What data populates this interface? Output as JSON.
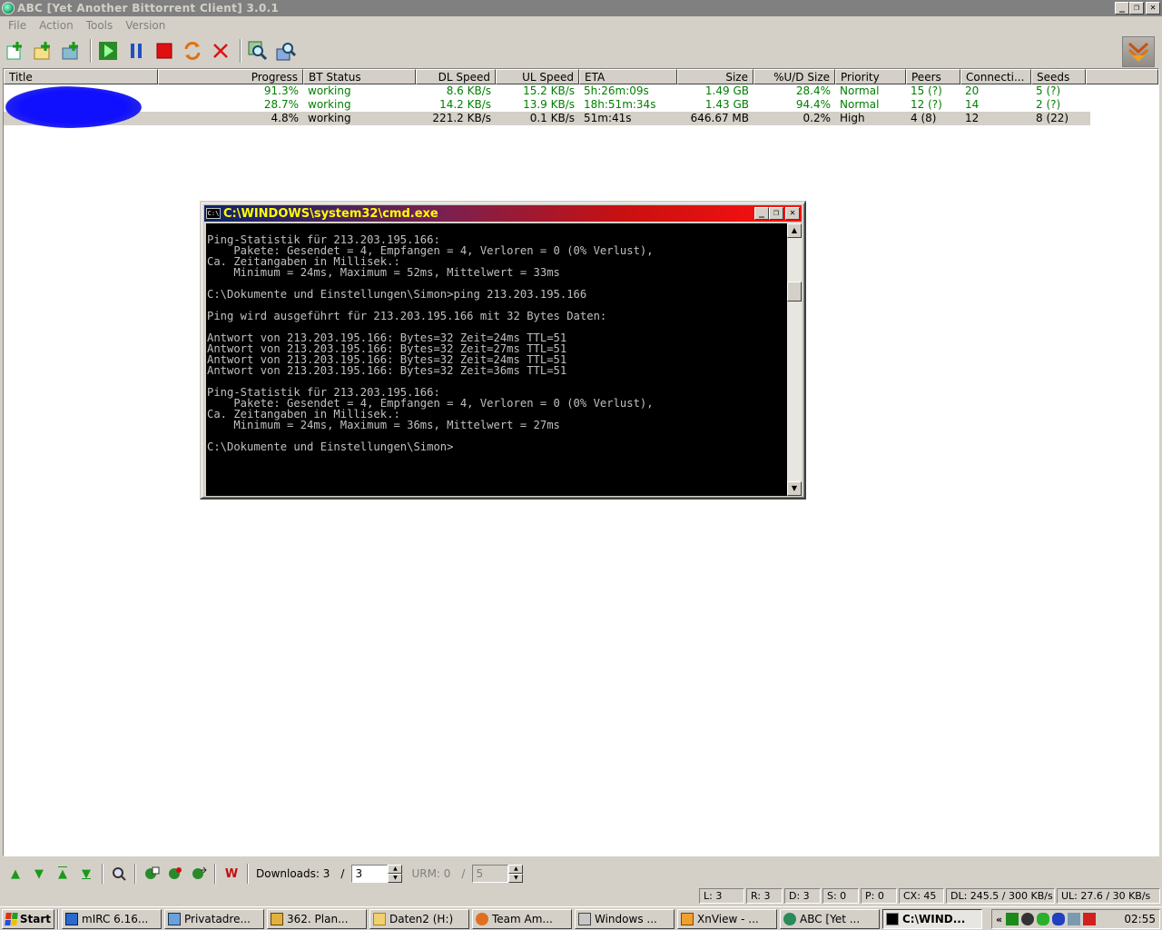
{
  "window": {
    "title": "ABC [Yet Another Bittorrent Client] 3.0.1",
    "buttons": {
      "minimize": "_",
      "maximize": "❐",
      "close": "✕"
    }
  },
  "menu": [
    "File",
    "Action",
    "Tools",
    "Version"
  ],
  "toolbar": {
    "icons": [
      "add-torrent-icon",
      "add-torrent-url-icon",
      "add-torrent-folder-icon",
      "resume-icon",
      "pause-icon",
      "stop-icon",
      "queue-icon",
      "remove-icon",
      "scrape-icon",
      "details-icon"
    ]
  },
  "torrent_list": {
    "columns": [
      "Title",
      "Progress",
      "BT Status",
      "DL Speed",
      "UL Speed",
      "ETA",
      "Size",
      "%U/D Size",
      "Priority",
      "Peers",
      "Connecti...",
      "Seeds"
    ],
    "rows": [
      {
        "title": "",
        "progress": "91.3%",
        "status": "working",
        "dl": "8.6 KB/s",
        "ul": "15.2 KB/s",
        "eta": "5h:26m:09s",
        "size": "1.49 GB",
        "ud": "28.4%",
        "priority": "Normal",
        "peers": "15 (?)",
        "conn": "20",
        "seeds": "5 (?)",
        "color": "green"
      },
      {
        "title": "",
        "progress": "28.7%",
        "status": "working",
        "dl": "14.2 KB/s",
        "ul": "13.9 KB/s",
        "eta": "18h:51m:34s",
        "size": "1.43 GB",
        "ud": "94.4%",
        "priority": "Normal",
        "peers": "12 (?)",
        "conn": "14",
        "seeds": "2 (?)",
        "color": "green"
      },
      {
        "title": "",
        "progress": "4.8%",
        "status": "working",
        "dl": "221.2 KB/s",
        "ul": "0.1 KB/s",
        "eta": "51m:41s",
        "size": "646.67 MB",
        "ud": "0.2%",
        "priority": "High",
        "peers": "4 (8)",
        "conn": "12",
        "seeds": "8 (22)",
        "color": "black"
      }
    ]
  },
  "console": {
    "title": "C:\\WINDOWS\\system32\\cmd.exe",
    "icon_text": "C:\\",
    "lines": [
      "Ping-Statistik für 213.203.195.166:",
      "    Pakete: Gesendet = 4, Empfangen = 4, Verloren = 0 (0% Verlust),",
      "Ca. Zeitangaben in Millisek.:",
      "    Minimum = 24ms, Maximum = 52ms, Mittelwert = 33ms",
      "",
      "C:\\Dokumente und Einstellungen\\Simon>ping 213.203.195.166",
      "",
      "Ping wird ausgeführt für 213.203.195.166 mit 32 Bytes Daten:",
      "",
      "Antwort von 213.203.195.166: Bytes=32 Zeit=24ms TTL=51",
      "Antwort von 213.203.195.166: Bytes=32 Zeit=27ms TTL=51",
      "Antwort von 213.203.195.166: Bytes=32 Zeit=24ms TTL=51",
      "Antwort von 213.203.195.166: Bytes=32 Zeit=36ms TTL=51",
      "",
      "Ping-Statistik für 213.203.195.166:",
      "    Pakete: Gesendet = 4, Empfangen = 4, Verloren = 0 (0% Verlust),",
      "Ca. Zeitangaben in Millisek.:",
      "    Minimum = 24ms, Maximum = 36ms, Mittelwert = 27ms",
      "",
      "C:\\Dokumente und Einstellungen\\Simon>"
    ]
  },
  "controls": {
    "downloads_label": "Downloads: 3",
    "slash1": "/",
    "downloads_value": "3",
    "urm_label": "URM: 0",
    "slash2": "/",
    "urm_value": "5"
  },
  "status": [
    "L: 3",
    "R: 3",
    "D: 3",
    "S: 0",
    "P: 0",
    "CX: 45",
    "DL: 245.5 / 300 KB/s",
    "UL: 27.6 / 30 KB/s"
  ],
  "taskbar": {
    "start": "Start",
    "tasks": [
      "mIRC 6.16...",
      "Privatadre...",
      "362. Plan...",
      "Daten2 (H:)",
      "Team Am...",
      "Windows ...",
      "XnView - ...",
      "ABC [Yet ...",
      "C:\\WIND..."
    ],
    "active_index": 8,
    "chevron": "«",
    "clock": "02:55"
  },
  "colors": {
    "progress_green": "#007f00",
    "console_bg": "#000000",
    "console_text": "#c0c0c0"
  }
}
